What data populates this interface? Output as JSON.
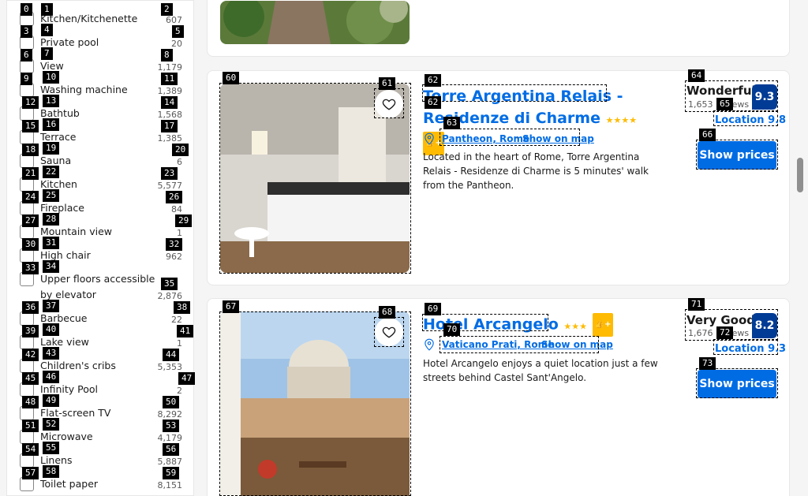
{
  "filters": [
    {
      "label": "Kitchen/Kitchenette",
      "count": "607"
    },
    {
      "label": "Private pool",
      "count": "20"
    },
    {
      "label": "View",
      "count": "1,179"
    },
    {
      "label": "Washing machine",
      "count": "1,389"
    },
    {
      "label": "Bathtub",
      "count": "1,568"
    },
    {
      "label": "Terrace",
      "count": "1,385"
    },
    {
      "label": "Sauna",
      "count": "6"
    },
    {
      "label": "Kitchen",
      "count": "5,577"
    },
    {
      "label": "Fireplace",
      "count": "84"
    },
    {
      "label": "Mountain view",
      "count": "1"
    },
    {
      "label": "High chair",
      "count": "962"
    },
    {
      "label": "Upper floors accessible by elevator",
      "count": "2,876"
    },
    {
      "label": "Barbecue",
      "count": "22"
    },
    {
      "label": "Lake view",
      "count": "1"
    },
    {
      "label": "Children's cribs",
      "count": "5,353"
    },
    {
      "label": "Infinity Pool",
      "count": "2"
    },
    {
      "label": "Flat-screen TV",
      "count": "8,292"
    },
    {
      "label": "Microwave",
      "count": "4,179"
    },
    {
      "label": "Linens",
      "count": "5,887"
    },
    {
      "label": "Toilet paper",
      "count": "8,151"
    }
  ],
  "hotels": [
    {
      "name_line1": "Torre Argentina Relais -",
      "name_line2": "Residenze di Charme",
      "stars": "★★★★",
      "location": "Pantheon, Rome",
      "map_link": "Show on map",
      "description": "Located in the heart of Rome, Torre Argentina Relais - Residenze di Charme is 5 minutes' walk from the Pantheon.",
      "review_word": "Wonderful",
      "review_count": "1,653 reviews",
      "score": "9.3",
      "location_score": "Location 9.8",
      "button": "Show prices"
    },
    {
      "name_line1": "Hotel Arcangelo",
      "stars": "★★★",
      "location": "Vaticano Prati, Rome",
      "map_link": "Show on map",
      "description": "Hotel Arcangelo enjoys a quiet location just a few streets behind Castel Sant'Angelo.",
      "review_word": "Very Good",
      "review_count": "1,676 reviews",
      "score": "8.2",
      "location_score": "Location 9.3",
      "button": "Show prices"
    }
  ],
  "plus_label": "👍+",
  "colors": {
    "link": "#006ce4",
    "score_bg": "#003b95",
    "star": "#febb02"
  }
}
